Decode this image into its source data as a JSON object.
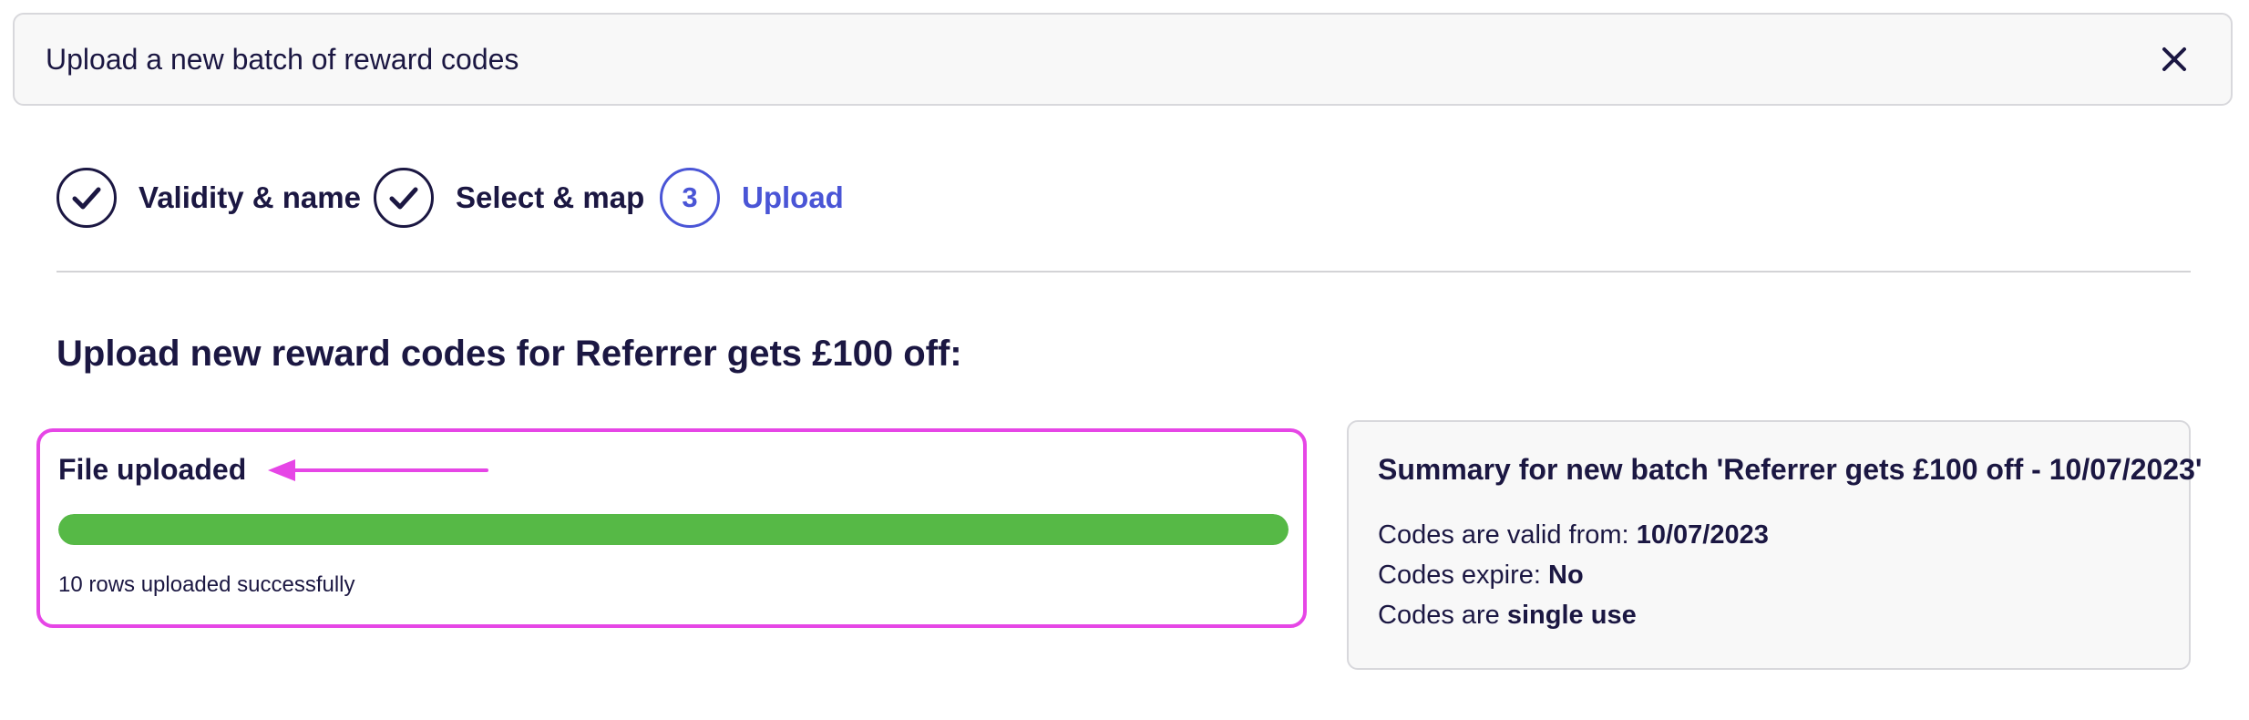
{
  "header": {
    "title": "Upload a new batch of reward codes",
    "close_icon": "close-icon"
  },
  "stepper": {
    "steps": [
      {
        "label": "Validity & name",
        "state": "complete",
        "icon": "check-icon"
      },
      {
        "label": "Select & map",
        "state": "complete",
        "icon": "check-icon"
      },
      {
        "label": "Upload",
        "state": "active",
        "number": "3"
      }
    ],
    "active_color": "#4a55d6"
  },
  "section": {
    "title": "Upload new reward codes for Referrer gets £100 off:"
  },
  "upload": {
    "status": "File uploaded",
    "progress_percent": 100,
    "progress_color": "#56b946",
    "message": "10 rows uploaded successfully",
    "highlight_color": "#e646e6",
    "annotation_icon": "arrow-left-icon"
  },
  "summary": {
    "title": "Summary for new batch 'Referrer gets £100 off - 10/07/2023'",
    "valid_from_label": "Codes are valid from:",
    "valid_from_value": "10/07/2023",
    "expire_label": "Codes expire:",
    "expire_value": "No",
    "use_label": "Codes are",
    "use_value": "single use"
  }
}
